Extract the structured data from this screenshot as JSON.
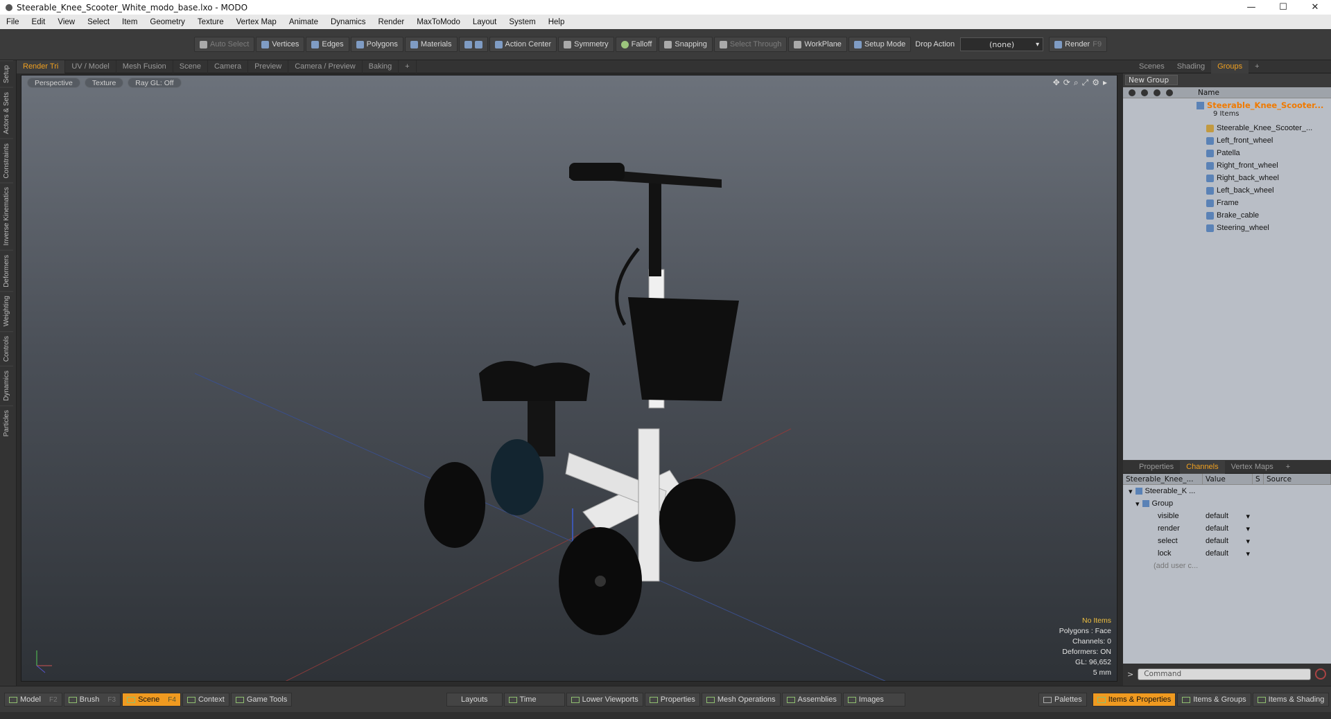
{
  "window": {
    "title": "Steerable_Knee_Scooter_White_modo_base.lxo - MODO"
  },
  "menu": [
    "File",
    "Edit",
    "View",
    "Select",
    "Item",
    "Geometry",
    "Texture",
    "Vertex Map",
    "Animate",
    "Dynamics",
    "Render",
    "MaxToModo",
    "Layout",
    "System",
    "Help"
  ],
  "toolbar": {
    "buttons": [
      "Auto Select",
      "Vertices",
      "Edges",
      "Polygons",
      "Materials",
      "Action Center",
      "Symmetry",
      "Falloff",
      "Snapping",
      "Select Through",
      "WorkPlane",
      "Setup Mode"
    ],
    "drop_action_label": "Drop Action",
    "drop_action_value": "(none)",
    "render_label": "Render",
    "render_key": "F9"
  },
  "left_tabs": [
    "Setup",
    "Actors & Sets",
    "Constraints",
    "Inverse Kinematics",
    "Deformers",
    "Weighting",
    "Controls",
    "Dynamics",
    "Particles"
  ],
  "viewport_tabs": [
    "Render Tri",
    "UV / Model",
    "Mesh Fusion",
    "Scene",
    "Camera",
    "Preview",
    "Camera / Preview",
    "Baking",
    "+"
  ],
  "viewport": {
    "view_mode": "Perspective",
    "shading": "Texture",
    "raygl": "Ray GL: Off",
    "info": {
      "items": "No Items",
      "polygons": "Polygons : Face",
      "channels": "Channels: 0",
      "deformers": "Deformers: ON",
      "gl": "GL: 96,652",
      "scale": "5 mm"
    }
  },
  "groups_panel": {
    "tabs": [
      "Scenes",
      "Shading",
      "Groups",
      "+"
    ],
    "new_group": "New Group",
    "name_header": "Name",
    "root": {
      "name": "Steerable_Knee_Scooter...",
      "count": "9 Items"
    },
    "items": [
      "Steerable_Knee_Scooter_...",
      "Left_front_wheel",
      "Patella",
      "Right_front_wheel",
      "Right_back_wheel",
      "Left_back_wheel",
      "Frame",
      "Brake_cable",
      "Steering_wheel"
    ]
  },
  "channels_panel": {
    "tabs": [
      "Properties",
      "Channels",
      "Vertex Maps",
      "+"
    ],
    "headers": [
      "Steerable_Knee_...",
      "Value",
      "S",
      "Source"
    ],
    "tree_root": "Steerable_K ...",
    "tree_group": "Group",
    "rows": [
      {
        "name": "visible",
        "value": "default"
      },
      {
        "name": "render",
        "value": "default"
      },
      {
        "name": "select",
        "value": "default"
      },
      {
        "name": "lock",
        "value": "default"
      }
    ],
    "add_user": "(add user c...",
    "command_placeholder": "Command"
  },
  "bottom_bar": {
    "left": [
      {
        "label": "Model",
        "key": "F2"
      },
      {
        "label": "Brush",
        "key": "F3"
      },
      {
        "label": "Scene",
        "key": "F4"
      },
      {
        "label": "Context",
        "key": ""
      },
      {
        "label": "Game Tools",
        "key": ""
      }
    ],
    "center": [
      "Layouts",
      "Time",
      "Lower Viewports",
      "Properties",
      "Mesh Operations",
      "Assemblies",
      "Images"
    ],
    "right": [
      "Palettes",
      "Items & Properties",
      "Items & Groups",
      "Items & Shading"
    ]
  },
  "colors": {
    "accent": "#f09a20",
    "root_item": "#f07a00"
  }
}
